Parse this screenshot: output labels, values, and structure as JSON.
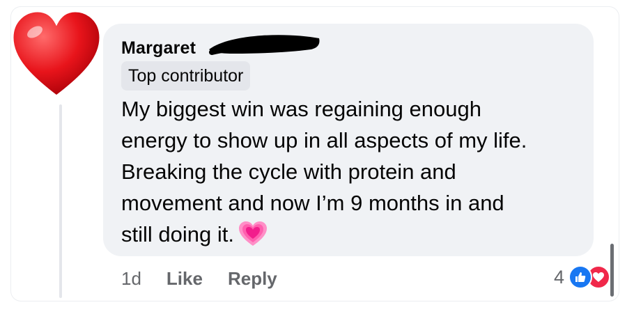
{
  "comment": {
    "author": "Margaret",
    "badge": "Top contributor",
    "text_lines": [
      "My biggest win was regaining enough",
      "energy to show up in all aspects of my life.",
      "Breaking the cycle with protein and",
      "movement and now I’m 9 months in and",
      "still doing it."
    ],
    "emoji": "growing-heart-emoji"
  },
  "actions": {
    "time": "1d",
    "like_label": "Like",
    "reply_label": "Reply"
  },
  "reactions": {
    "count": "4",
    "icons": [
      "thumbs-up-icon",
      "heart-icon"
    ]
  },
  "avatar": {
    "icon": "red-heart-icon"
  },
  "colors": {
    "bubble": "#f0f2f5",
    "badge": "#e4e6eb",
    "text": "#050505",
    "secondary_text": "#65676b",
    "like_blue": "#1877f2",
    "love_red": "#f0284a",
    "avatar_heart": "#e8141b"
  }
}
